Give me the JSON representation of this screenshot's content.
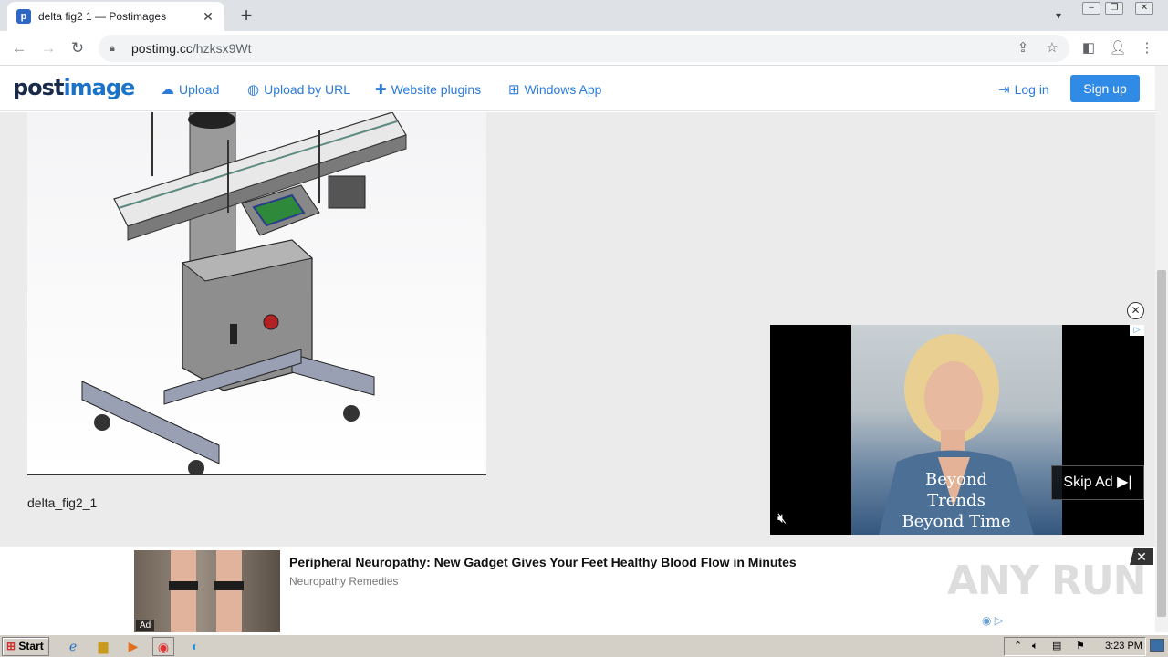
{
  "browser": {
    "tab_title": "delta fig2 1 — Postimages",
    "tab_favicon": "postimages-favicon",
    "url_domain": "postimg.cc",
    "url_path": "/hzksx9Wt"
  },
  "site": {
    "logo_part1": "post",
    "logo_part2": "image",
    "nav": {
      "upload": "Upload",
      "upload_url": "Upload by URL",
      "plugins": "Website plugins",
      "windows_app": "Windows App",
      "login": "Log in",
      "signup": "Sign up"
    }
  },
  "content": {
    "caption": "delta_fig2_1"
  },
  "video_ad": {
    "text_line1": "Beyond Trends",
    "text_line2": "Beyond Time",
    "skip_label": "Skip Ad"
  },
  "bottom_ad": {
    "label": "Ad",
    "title": "Peripheral Neuropathy: New Gadget Gives Your Feet Healthy Blood Flow in Minutes",
    "source": "Neuropathy Remedies"
  },
  "watermark": "ANY RUN",
  "taskbar": {
    "start_label": "Start",
    "clock": "3:23 PM"
  },
  "colors": {
    "accent": "#2c7bd9",
    "signup_bg": "#2f8be6"
  }
}
